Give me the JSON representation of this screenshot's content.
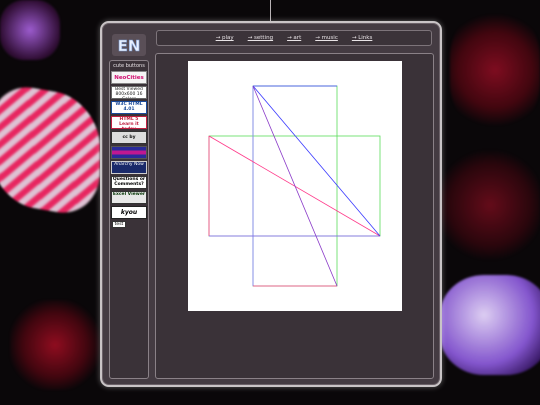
{
  "logo": {
    "text": "EN"
  },
  "nav": {
    "links": [
      "→ play",
      "→ setting",
      "→ art",
      "→ music",
      "→ Links"
    ]
  },
  "sidebar": {
    "title": "cute buttons",
    "buttons": [
      {
        "label": "NeoCities",
        "icon": "neocities-badge"
      },
      {
        "label": "Best Viewed 800x600 16 Colors",
        "icon": "resolution-badge"
      },
      {
        "label": "W3C HTML 4.01",
        "icon": "w3c-html-badge"
      },
      {
        "label": "HTML 5 Learn it today",
        "icon": "html5-badge"
      },
      {
        "label": "cc by",
        "icon": "creative-commons-badge"
      },
      {
        "label": "",
        "icon": "purple-stripe-badge"
      },
      {
        "label": "Anarchy Now",
        "icon": "anarchy-badge"
      },
      {
        "label": "Questions or Comments?",
        "icon": "questions-badge"
      },
      {
        "label": "Excel Viewer",
        "icon": "excel-viewer-badge"
      },
      {
        "label": "kyou",
        "icon": "kyou-badge"
      },
      {
        "label": "test",
        "icon": "test-badge"
      }
    ]
  },
  "colors": {
    "window_bg": "#443b42",
    "panel_bg": "#3a3238",
    "border": "#c9c4c6",
    "blue_line": "#3a3aff",
    "green_line": "#5adc5a",
    "red_line": "#ff3a8a"
  }
}
